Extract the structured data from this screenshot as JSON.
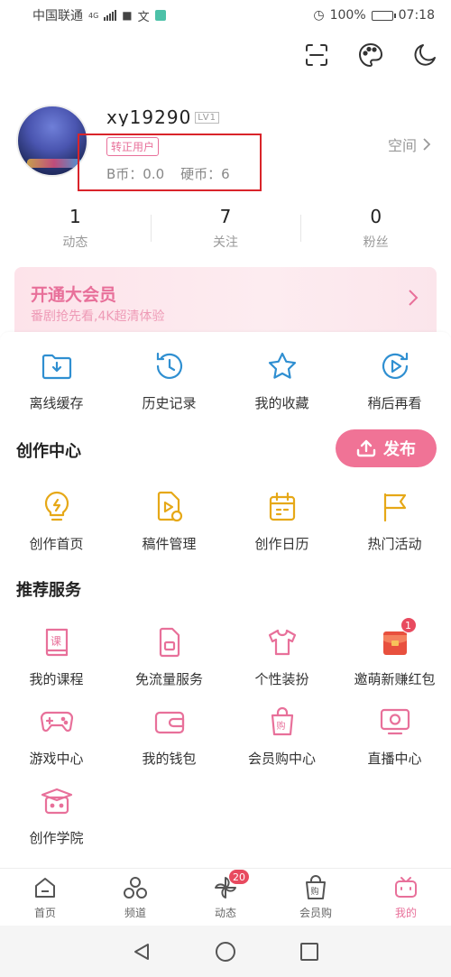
{
  "status": {
    "carrier": "中国联通",
    "network": "4G",
    "battery": "100%",
    "time": "07:18"
  },
  "top_icons": [
    "scan-icon",
    "palette-icon",
    "moon-icon"
  ],
  "profile": {
    "username": "xy19290",
    "level_tag": "LV1",
    "vip_badge": "转正用户",
    "bcoin": "B币：0.0",
    "coins": "硬币：6",
    "space_label": "空间"
  },
  "stats": [
    {
      "num": "1",
      "label": "动态"
    },
    {
      "num": "7",
      "label": "关注"
    },
    {
      "num": "0",
      "label": "粉丝"
    }
  ],
  "vip_card": {
    "title": "开通大会员",
    "subtitle": "番剧抢先看,4K超清体验"
  },
  "quick_actions": [
    {
      "label": "离线缓存",
      "icon": "download-folder-icon"
    },
    {
      "label": "历史记录",
      "icon": "history-clock-icon"
    },
    {
      "label": "我的收藏",
      "icon": "star-icon"
    },
    {
      "label": "稍后再看",
      "icon": "watch-later-icon"
    }
  ],
  "creation": {
    "title": "创作中心",
    "publish_label": "发布",
    "items": [
      {
        "label": "创作首页",
        "icon": "bulb-icon"
      },
      {
        "label": "稿件管理",
        "icon": "manuscript-icon"
      },
      {
        "label": "创作日历",
        "icon": "calendar-icon"
      },
      {
        "label": "热门活动",
        "icon": "flag-icon"
      }
    ]
  },
  "services": {
    "title": "推荐服务",
    "items": [
      {
        "label": "我的课程",
        "icon": "course-book-icon"
      },
      {
        "label": "免流量服务",
        "icon": "sim-card-icon"
      },
      {
        "label": "个性装扮",
        "icon": "tshirt-icon"
      },
      {
        "label": "邀萌新赚红包",
        "icon": "red-envelope-icon",
        "badge": "1"
      },
      {
        "label": "游戏中心",
        "icon": "gamepad-icon"
      },
      {
        "label": "我的钱包",
        "icon": "wallet-icon"
      },
      {
        "label": "会员购中心",
        "icon": "shopping-bag-icon"
      },
      {
        "label": "直播中心",
        "icon": "live-tv-icon"
      },
      {
        "label": "创作学院",
        "icon": "graduation-icon"
      }
    ]
  },
  "tabs": [
    {
      "label": "首页",
      "icon": "home-icon"
    },
    {
      "label": "频道",
      "icon": "channel-icon"
    },
    {
      "label": "动态",
      "icon": "pinwheel-icon",
      "badge": "20"
    },
    {
      "label": "会员购",
      "icon": "shopping-bag-icon"
    },
    {
      "label": "我的",
      "icon": "tv-mascot-icon",
      "active": true
    }
  ],
  "colors": {
    "accent": "#f07396",
    "blue_icon": "#2f8fd1",
    "gold_icon": "#e6a817",
    "pink_icon": "#e8709a",
    "highlight_box": "#d9242a"
  }
}
